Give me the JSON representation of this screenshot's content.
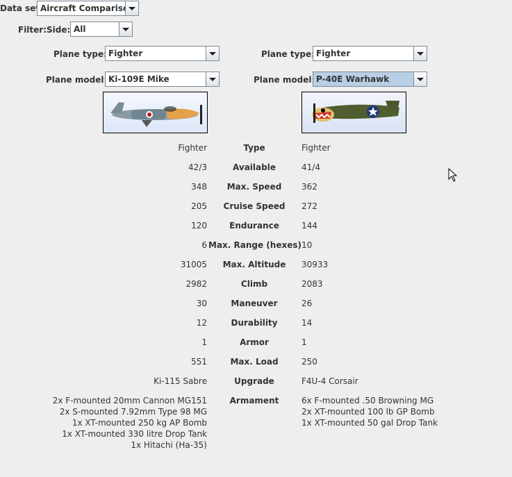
{
  "dataset": {
    "label": "Data set:",
    "value": "Aircraft Comparison"
  },
  "filter": {
    "label": "Filter:",
    "side_label": "Side:",
    "side_value": "All"
  },
  "left": {
    "plane_type_label": "Plane type:",
    "plane_type": "Fighter",
    "plane_model_label": "Plane model:",
    "plane_model": "Ki-109E Mike"
  },
  "right": {
    "plane_type_label": "Plane type:",
    "plane_type": "Fighter",
    "plane_model_label": "Plane model:",
    "plane_model": "P-40E Warhawk"
  },
  "stats": [
    {
      "label": "Type",
      "left": "Fighter",
      "right": "Fighter"
    },
    {
      "label": "Available",
      "left": "42/3",
      "right": "41/4"
    },
    {
      "label": "Max. Speed",
      "left": "348",
      "right": "362"
    },
    {
      "label": "Cruise Speed",
      "left": "205",
      "right": "272"
    },
    {
      "label": "Endurance",
      "left": "120",
      "right": "144"
    },
    {
      "label": "Max. Range (hexes)",
      "left": "6",
      "right": "10"
    },
    {
      "label": "Max. Altitude",
      "left": "31005",
      "right": "30933"
    },
    {
      "label": "Climb",
      "left": "2982",
      "right": "2083"
    },
    {
      "label": "Maneuver",
      "left": "30",
      "right": "26"
    },
    {
      "label": "Durability",
      "left": "12",
      "right": "14"
    },
    {
      "label": "Armor",
      "left": "1",
      "right": "1"
    },
    {
      "label": "Max. Load",
      "left": "551",
      "right": "250"
    },
    {
      "label": "Upgrade",
      "left": "Ki-115 Sabre",
      "right": "F4U-4 Corsair"
    }
  ],
  "armament": {
    "label": "Armament",
    "left": [
      "2x F-mounted 20mm Cannon MG151",
      "2x S-mounted 7.92mm Type 98 MG",
      "1x XT-mounted 250 kg AP Bomb",
      "1x XT-mounted 330 litre Drop Tank",
      "1x Hitachi (Ha-35)"
    ],
    "right": [
      "6x F-mounted .50 Browning MG",
      "2x XT-mounted 100 lb GP Bomb",
      "1x XT-mounted 50 gal Drop Tank"
    ]
  },
  "icons": [
    "chevron-down-icon",
    "mouse-pointer-icon"
  ]
}
